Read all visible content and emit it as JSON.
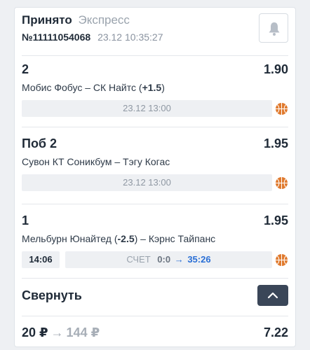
{
  "header": {
    "status": "Принято",
    "bet_type": "Экспресс",
    "bet_number": "№11111054068",
    "datetime": "23.12 10:35:27"
  },
  "selections": [
    {
      "outcome": "2",
      "odds": "1.90",
      "match_text": "Мобис Фобус – СК Найтс (",
      "handicap": "+1.5",
      "match_suffix": ")",
      "start": "23.12 13:00",
      "sport_icon": "basketball-icon"
    },
    {
      "outcome": "Поб 2",
      "odds": "1.95",
      "match_text": "Сувон КТ Соникбум – Тэгу Когас",
      "start": "23.12 13:00",
      "sport_icon": "basketball-icon"
    },
    {
      "outcome": "1",
      "odds": "1.95",
      "match_prefix": "Мельбурн Юнайтед (",
      "handicap": "-2.5",
      "match_rest": ") – Кэрнс Тайпанс",
      "live_time": "14:06",
      "score_label": "СЧЕТ",
      "score_from": "0:0",
      "score_arrow": "→",
      "score_to": "35:26",
      "sport_icon": "basketball-icon"
    }
  ],
  "collapse": {
    "label": "Свернуть"
  },
  "totals": {
    "stake": "20 ₽",
    "arrow": "→",
    "payout": "144 ₽",
    "total_odds": "7.22"
  },
  "colors": {
    "accent_blue": "#2a6fd6",
    "dark_button": "#3a4658",
    "basketball": "#e07a2e"
  }
}
